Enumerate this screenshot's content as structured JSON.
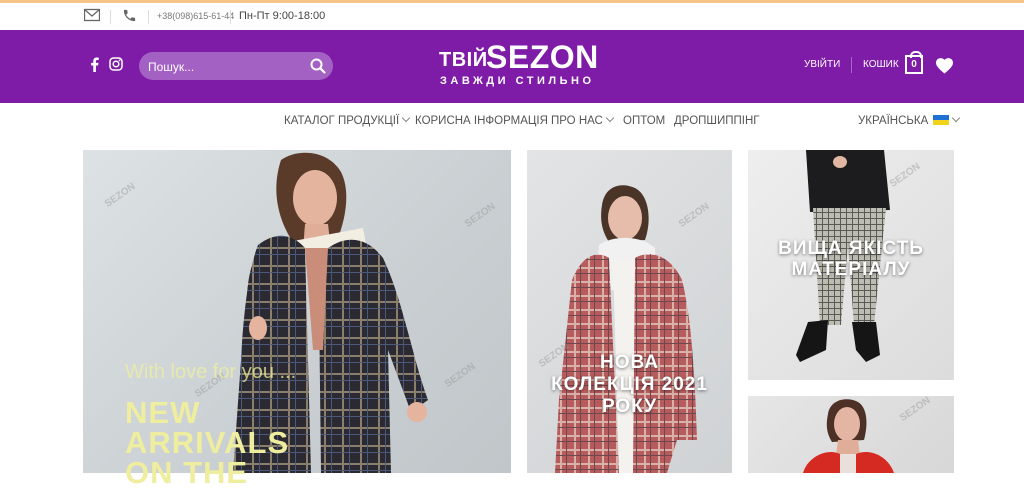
{
  "topbar": {
    "phone": "+38(098)615-61-44",
    "hours": "Пн-Пт 9:00-18:00",
    "icons": [
      "envelope-icon",
      "phone-icon"
    ]
  },
  "header": {
    "search_placeholder": "Пошук...",
    "logo": {
      "line1": "ТВІЙ",
      "line2": "SEZON",
      "line3": "ЗАВЖДИ СТИЛЬНО"
    },
    "login": "УВІЙТИ",
    "cart_label": "КОШИК",
    "cart_count": "0",
    "colors": {
      "brand": "#7e1ba7",
      "search_bg": "#a461c4"
    }
  },
  "nav": {
    "items": [
      {
        "label": "КАТАЛОГ ПРОДУКЦІЇ",
        "has_dropdown": true
      },
      {
        "label": "КОРИСНА ІНФОРМАЦІЯ",
        "has_dropdown": false
      },
      {
        "label": "ПРО НАС",
        "has_dropdown": true
      },
      {
        "label": "ОПТОМ",
        "has_dropdown": false
      },
      {
        "label": "ДРОПШИППІНГ",
        "has_dropdown": false
      }
    ],
    "language": "УКРАЇНСЬКА"
  },
  "banners": {
    "main": {
      "tagline": "With love for you ...",
      "line1": "NEW",
      "line2": "ARRIVALS",
      "line3": "ON THE"
    },
    "middle": {
      "line1": "НОВА",
      "line2": "КОЛЕКЦІЯ 2021",
      "line3": "РОКУ"
    },
    "right_top": {
      "line1": "ВИЩА ЯКІСТЬ",
      "line2": "МАТЕРІАЛУ"
    }
  }
}
